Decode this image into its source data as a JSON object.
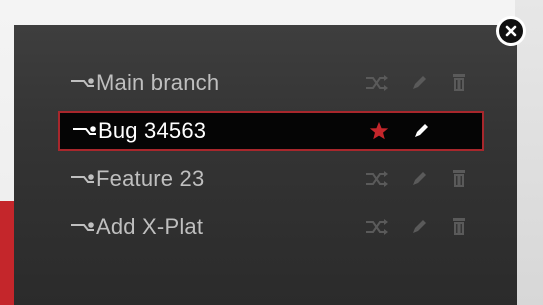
{
  "branches": [
    {
      "label": "Main branch",
      "selected": false,
      "actions": [
        "merge-icon",
        "pencil-icon",
        "trash-icon"
      ]
    },
    {
      "label": "Bug 34563",
      "selected": true,
      "actions": [
        "star-icon",
        "pencil-icon"
      ]
    },
    {
      "label": "Feature 23",
      "selected": false,
      "actions": [
        "merge-icon",
        "pencil-icon",
        "trash-icon"
      ]
    },
    {
      "label": "Add X-Plat",
      "selected": false,
      "actions": [
        "merge-icon",
        "pencil-icon",
        "trash-icon"
      ]
    }
  ],
  "colors": {
    "accent": "#c4262b",
    "panel": "#353535",
    "selected_bg": "#050505",
    "label": "#bfbfbf",
    "selected_label": "#ffffff",
    "icon_muted": "#5a5a5a"
  }
}
